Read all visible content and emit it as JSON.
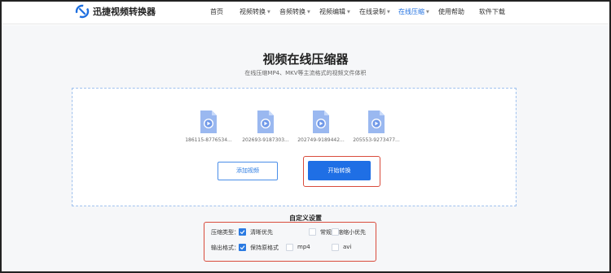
{
  "header": {
    "brand": "迅捷视频转换器",
    "nav": [
      {
        "label": "首页",
        "dropdown": false,
        "active": false
      },
      {
        "label": "视频转换",
        "dropdown": true,
        "active": false
      },
      {
        "label": "音频转换",
        "dropdown": true,
        "active": false
      },
      {
        "label": "视频编辑",
        "dropdown": true,
        "active": false
      },
      {
        "label": "在线录制",
        "dropdown": true,
        "active": false
      },
      {
        "label": "在线压缩",
        "dropdown": true,
        "active": true
      },
      {
        "label": "使用帮助",
        "dropdown": false,
        "active": false
      },
      {
        "label": "软件下载",
        "dropdown": false,
        "active": false
      }
    ]
  },
  "main": {
    "title": "视频在线压缩器",
    "subtitle": "在线压缩MP4、MKV等主流格式的视频文件体积"
  },
  "files": [
    {
      "name": "186115-8776534..."
    },
    {
      "name": "202693-9187303..."
    },
    {
      "name": "202749-9189442..."
    },
    {
      "name": "205553-9273477..."
    }
  ],
  "buttons": {
    "add": "添加视频",
    "start": "开始转换"
  },
  "settings": {
    "title": "自定义设置",
    "compress_type": {
      "label": "压缩类型：",
      "options": [
        {
          "label": "清晰优先",
          "checked": true
        },
        {
          "label": "常规压缩",
          "checked": false
        },
        {
          "label": "缩小优先",
          "checked": false
        }
      ]
    },
    "output_format": {
      "label": "输出格式：",
      "options": [
        {
          "label": "保持原格式",
          "checked": true
        },
        {
          "label": "mp4",
          "checked": false
        },
        {
          "label": "avi",
          "checked": false
        }
      ]
    }
  },
  "colors": {
    "accent": "#1f6fe5",
    "highlight": "#d94b3c",
    "file_icon": "#9ab8f0"
  }
}
